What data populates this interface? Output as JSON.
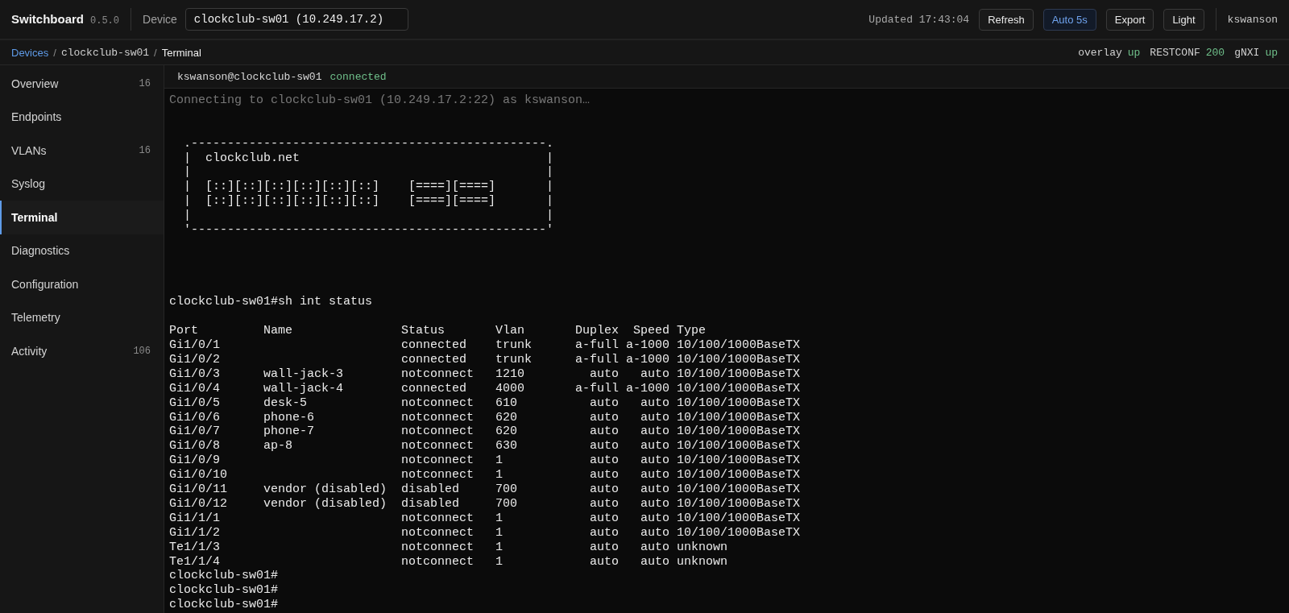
{
  "app": {
    "name": "Switchboard",
    "version": "0.5.0"
  },
  "topbar": {
    "device_label": "Device",
    "device_value": "clockclub-sw01 (10.249.17.2)",
    "updated": "Updated 17:43:04",
    "buttons": [
      {
        "label": "Refresh",
        "active": false
      },
      {
        "label": "Auto 5s",
        "active": true
      },
      {
        "label": "Export",
        "active": false
      },
      {
        "label": "Light",
        "active": false
      }
    ],
    "user": "kswanson"
  },
  "breadcrumb": [
    {
      "label": "Devices",
      "kind": "link"
    },
    {
      "label": "/",
      "kind": "separator"
    },
    {
      "label": "clockclub-sw01",
      "kind": "mono"
    },
    {
      "label": "/",
      "kind": "separator"
    },
    {
      "label": "Terminal",
      "kind": "current"
    }
  ],
  "status": [
    {
      "name": "overlay",
      "value": "up"
    },
    {
      "name": "RESTCONF",
      "value": "200"
    },
    {
      "name": "gNXI",
      "value": "up"
    }
  ],
  "sidebar": {
    "items": [
      {
        "label": "Overview",
        "count": "16",
        "selected": false
      },
      {
        "label": "Endpoints",
        "selected": false
      },
      {
        "label": "VLANs",
        "count": "16",
        "selected": false
      },
      {
        "label": "Syslog",
        "selected": false
      },
      {
        "label": "Terminal",
        "selected": true
      },
      {
        "label": "Diagnostics",
        "selected": false
      },
      {
        "label": "Configuration",
        "selected": false
      },
      {
        "label": "Telemetry",
        "selected": false
      },
      {
        "label": "Activity",
        "count": "106",
        "selected": false
      }
    ]
  },
  "terminal": {
    "session": "kswanson@clockclub-sw01",
    "state": "connected",
    "intro": [
      {
        "kind": "info",
        "text": "Connecting to clockclub-sw01 (10.249.17.2:22) as kswanson…"
      },
      {
        "kind": "blank"
      },
      {
        "kind": "blank"
      },
      {
        "kind": "text",
        "text": "  .-------------------------------------------------."
      },
      {
        "kind": "text",
        "text": "  |  clockclub.net                                  |"
      },
      {
        "kind": "text",
        "text": "  |                                                 |"
      },
      {
        "kind": "text",
        "text": "  |  [::][::][::][::][::][::]    [====][====]       |"
      },
      {
        "kind": "text",
        "text": "  |  [::][::][::][::][::][::]    [====][====]       |"
      },
      {
        "kind": "text",
        "text": "  |                                                 |"
      },
      {
        "kind": "text",
        "text": "  '-------------------------------------------------'"
      },
      {
        "kind": "blank"
      },
      {
        "kind": "blank"
      },
      {
        "kind": "blank"
      },
      {
        "kind": "blank"
      },
      {
        "kind": "text",
        "text": "clockclub-sw01#sh int status"
      },
      {
        "kind": "blank"
      }
    ],
    "table": {
      "columns": [
        "Port",
        "Name",
        "Status",
        "Vlan",
        "Duplex",
        "Speed",
        "Type"
      ],
      "rows": [
        {
          "port": "Gi1/0/1",
          "status": "connected",
          "vlan": "trunk",
          "duplex": "a-full",
          "speed": "a-1000",
          "type": "10/100/1000BaseTX"
        },
        {
          "port": "Gi1/0/2",
          "status": "connected",
          "vlan": "trunk",
          "duplex": "a-full",
          "speed": "a-1000",
          "type": "10/100/1000BaseTX"
        },
        {
          "port": "Gi1/0/3",
          "name": "wall-jack-3",
          "status": "notconnect",
          "vlan": "1210",
          "duplex": "auto",
          "speed": "auto",
          "type": "10/100/1000BaseTX"
        },
        {
          "port": "Gi1/0/4",
          "name": "wall-jack-4",
          "status": "connected",
          "vlan": "4000",
          "duplex": "a-full",
          "speed": "a-1000",
          "type": "10/100/1000BaseTX"
        },
        {
          "port": "Gi1/0/5",
          "name": "desk-5",
          "status": "notconnect",
          "vlan": "610",
          "duplex": "auto",
          "speed": "auto",
          "type": "10/100/1000BaseTX"
        },
        {
          "port": "Gi1/0/6",
          "name": "phone-6",
          "status": "notconnect",
          "vlan": "620",
          "duplex": "auto",
          "speed": "auto",
          "type": "10/100/1000BaseTX"
        },
        {
          "port": "Gi1/0/7",
          "name": "phone-7",
          "status": "notconnect",
          "vlan": "620",
          "duplex": "auto",
          "speed": "auto",
          "type": "10/100/1000BaseTX"
        },
        {
          "port": "Gi1/0/8",
          "name": "ap-8",
          "status": "notconnect",
          "vlan": "630",
          "duplex": "auto",
          "speed": "auto",
          "type": "10/100/1000BaseTX"
        },
        {
          "port": "Gi1/0/9",
          "status": "notconnect",
          "vlan": "1",
          "duplex": "auto",
          "speed": "auto",
          "type": "10/100/1000BaseTX"
        },
        {
          "port": "Gi1/0/10",
          "status": "notconnect",
          "vlan": "1",
          "duplex": "auto",
          "speed": "auto",
          "type": "10/100/1000BaseTX"
        },
        {
          "port": "Gi1/0/11",
          "name": "vendor (disabled)",
          "status": "disabled",
          "vlan": "700",
          "duplex": "auto",
          "speed": "auto",
          "type": "10/100/1000BaseTX"
        },
        {
          "port": "Gi1/0/12",
          "name": "vendor (disabled)",
          "status": "disabled",
          "vlan": "700",
          "duplex": "auto",
          "speed": "auto",
          "type": "10/100/1000BaseTX"
        },
        {
          "port": "Gi1/1/1",
          "status": "notconnect",
          "vlan": "1",
          "duplex": "auto",
          "speed": "auto",
          "type": "10/100/1000BaseTX"
        },
        {
          "port": "Gi1/1/2",
          "status": "notconnect",
          "vlan": "1",
          "duplex": "auto",
          "speed": "auto",
          "type": "10/100/1000BaseTX"
        },
        {
          "port": "Te1/1/3",
          "status": "notconnect",
          "vlan": "1",
          "duplex": "auto",
          "speed": "auto",
          "type": "unknown"
        },
        {
          "port": "Te1/1/4",
          "status": "notconnect",
          "vlan": "1",
          "duplex": "auto",
          "speed": "auto",
          "type": "unknown"
        }
      ]
    },
    "outro": [
      {
        "kind": "text",
        "text": "clockclub-sw01#"
      },
      {
        "kind": "text",
        "text": "clockclub-sw01#"
      },
      {
        "kind": "text",
        "text": "clockclub-sw01#"
      }
    ]
  }
}
